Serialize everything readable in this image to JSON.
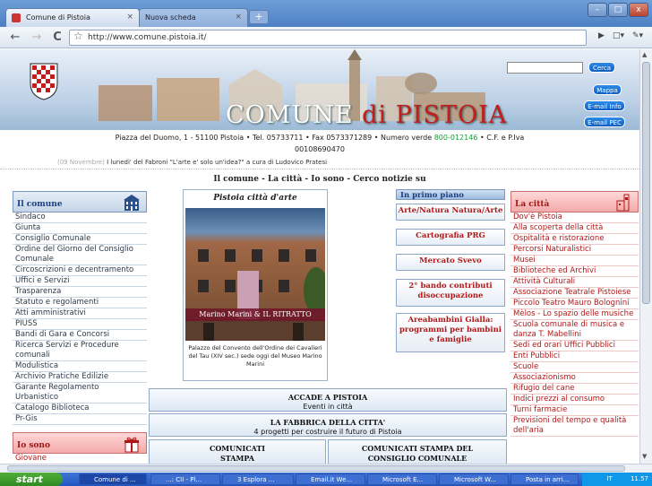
{
  "browser": {
    "tabs": [
      {
        "label": "Comune di Pistoia",
        "active": true
      },
      {
        "label": "Nuova scheda",
        "active": false
      }
    ],
    "new_tab": "+",
    "url": "http://www.comune.pistoia.it/",
    "window_buttons": [
      "–",
      "□",
      "x"
    ],
    "toolbar_right": [
      "▶",
      "□▾",
      "🔧▾"
    ]
  },
  "site": {
    "title_part1": "COMUNE",
    "title_part2": "di",
    "title_part3": "PISTOIA",
    "search_button": "Cerca",
    "buttons": [
      "Mappa",
      "E-mail Info",
      "E-mail PEC"
    ],
    "address_line1": "Piazza del Duomo, 1 - 51100 Pistoia • Tel. 05733711 • Fax 0573371289 • Numero verde ",
    "numero_verde": "800-012146",
    "address_line1_end": " • C.F. e P.Iva",
    "address_line2": "00108690470",
    "news_date": "(09 Novembre)",
    "news_text": " I lunedi' del Fabroni \"L'arte e' solo un'idea?\" a cura di Ludovico Pratesi",
    "topmenu": "Il comune  -  La città  -  Io sono  -  Cerco notizie su"
  },
  "left": {
    "title": "Il comune",
    "links": [
      "Sindaco",
      "Giunta",
      "Consiglio Comunale",
      "Ordine del Giorno del Consiglio Comunale",
      "Circoscrizioni e decentramento",
      "Uffici e Servizi",
      "Trasparenza",
      "Statuto e regolamenti",
      "Atti amministrativi",
      "PIUSS",
      "Bandi di Gara e Concorsi",
      "Ricerca Servizi e Procedure comunali",
      "Modulistica",
      "Archivio Pratiche Edilizie",
      "Garante Regolamento Urbanistico",
      "Catalogo Biblioteca",
      "Pr-Gis"
    ],
    "title2": "Io sono",
    "links2": [
      "Giovane"
    ]
  },
  "center": {
    "feature_title": "Pistoia città d'arte",
    "banner_text": "Marino Marini & IL RITRATTO",
    "caption": "Palazzo del Convento dell'Ordine dei Cavalieri del Tau (XIV sec.) sede oggi del Museo Marino Marini",
    "primo_piano": "In primo piano",
    "pp_items": [
      "Arte/Natura Natura/Arte",
      "Cartografia PRG",
      "Mercato Svevo",
      "2° bando contributi disoccupazione",
      "Areabambini Gialla: programmi per bambini e famiglie"
    ],
    "accade_title": "ACCADE A PISTOIA",
    "accade_sub": "Eventi in città",
    "fabbrica_title": "LA FABBRICA DELLA CITTA'",
    "fabbrica_sub": "4 progetti per costruire il futuro di Pistoia",
    "comunicati1": "COMUNICATI STAMPA",
    "comunicati2": "COMUNICATI STAMPA DEL CONSIGLIO COMUNALE"
  },
  "right": {
    "title": "La città",
    "links": [
      "Dov'è Pistoia",
      "Alla scoperta della città",
      "Ospitalità e ristorazione",
      "Percorsi Naturalistici",
      "Musei",
      "Biblioteche ed Archivi",
      "Attività Culturali",
      "Associazione Teatrale Pistoiese",
      "Piccolo Teatro Mauro Bolognini",
      "Mèlos - Lo spazio delle musiche",
      "Scuola comunale di musica e danza T. Mabellini",
      "Sedi ed orari Uffici Pubblici",
      "Enti Pubblici",
      "Scuole",
      "Associazionismo",
      "Rifugio del cane",
      "Indici prezzi al consumo",
      "Turni farmacie",
      "Previsioni del tempo e qualità dell'aria"
    ]
  },
  "taskbar": {
    "start": "start",
    "items": [
      "Comune di ...",
      "...: CII - Pl...",
      "3 Esplora ...",
      "Email.it We...",
      "Microsoft E...",
      "Microsoft W...",
      "Posta in arri..."
    ],
    "lang": "IT",
    "clock": "11.57"
  },
  "colors": {
    "accent_red": "#b01818",
    "accent_blue": "#1a3f80",
    "numero_verde": "#1a9a3a"
  }
}
